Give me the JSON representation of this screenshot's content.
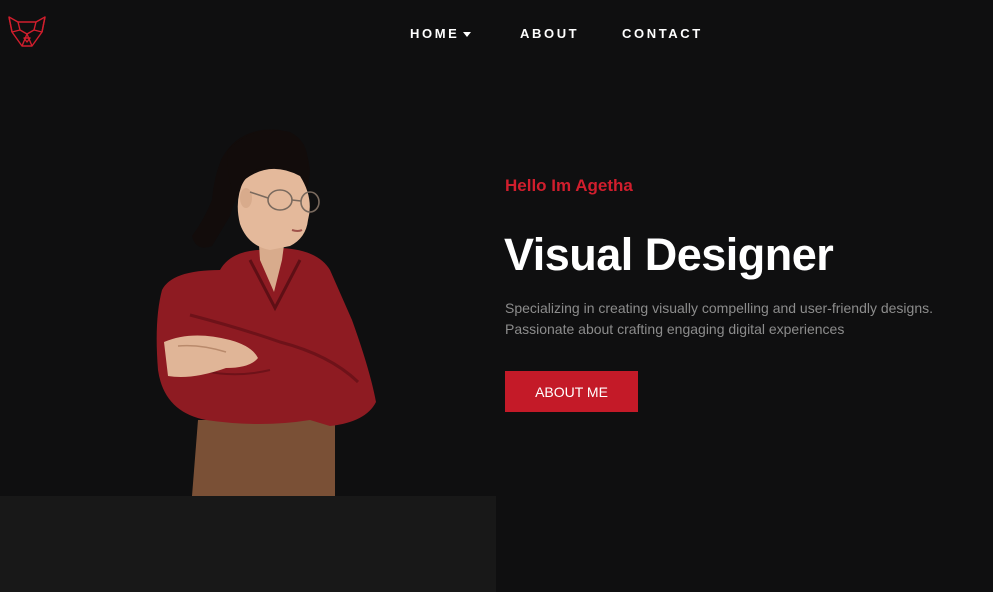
{
  "header": {
    "logo_icon": "fox-head-icon",
    "nav": [
      {
        "label": "HOME"
      },
      {
        "label": "ABOUT"
      },
      {
        "label": "CONTACT"
      }
    ]
  },
  "hero": {
    "greeting": "Hello Im Agetha",
    "title": "Visual Designer",
    "description_lines": [
      "Specializing in creating visually compelling and user-friendly designs.",
      "Passionate about crafting engaging digital experiences"
    ],
    "cta_label": "ABOUT ME"
  },
  "colors": {
    "background": "#0f0f10",
    "accent": "#c41a28",
    "greeting": "#d11e2d",
    "text_muted": "#8c8c8c",
    "panel": "#181818"
  }
}
